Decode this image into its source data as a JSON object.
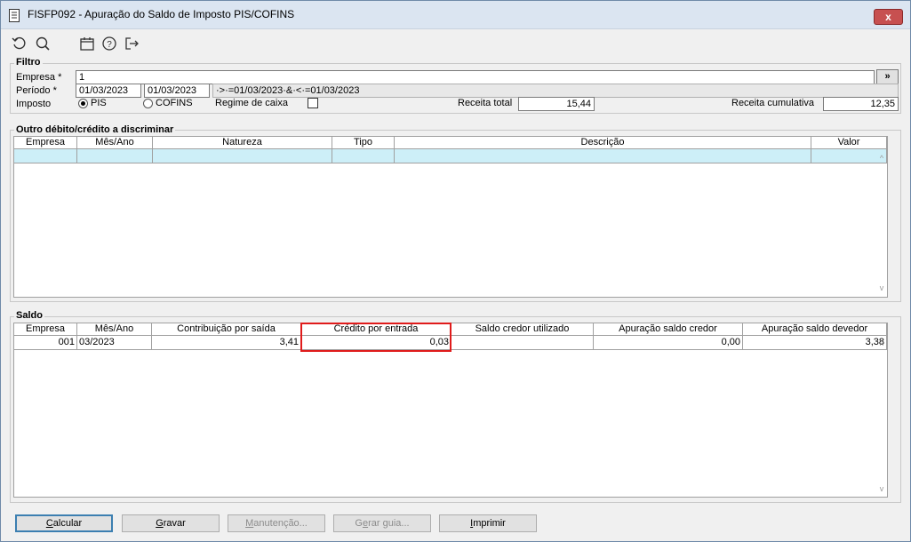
{
  "window": {
    "title": "FISFP092 - Apuração do Saldo de Imposto PIS/COFINS",
    "close_label": "x"
  },
  "toolbar": {
    "icons": [
      "refresh-icon",
      "search-icon",
      "calendar-icon",
      "help-icon",
      "exit-icon"
    ]
  },
  "filtro": {
    "legend": "Filtro",
    "empresa_label": "Empresa *",
    "empresa_value": "1",
    "lookup_label": "»",
    "periodo_label": "Período *",
    "periodo_de": "01/03/2023",
    "periodo_ate": "01/03/2023",
    "periodo_expr": "·>·=01/03/2023·&·<·=01/03/2023",
    "imposto_label": "Imposto",
    "imposto_options": [
      "PIS",
      "COFINS"
    ],
    "imposto_selected": "PIS",
    "regime_label": "Regime de caixa",
    "regime_checked": false,
    "receita_total_label": "Receita total",
    "receita_total_value": "15,44",
    "receita_cumulativa_label": "Receita cumulativa",
    "receita_cumulativa_value": "12,35"
  },
  "outros": {
    "legend": "Outro débito/crédito a discriminar",
    "columns": [
      "Empresa",
      "Mês/Ano",
      "Natureza",
      "Tipo",
      "Descrição",
      "Valor"
    ]
  },
  "saldo": {
    "legend": "Saldo",
    "columns": [
      "Empresa",
      "Mês/Ano",
      "Contribuição por saída",
      "Crédito por entrada",
      "Saldo credor utilizado",
      "Apuração saldo credor",
      "Apuração saldo devedor"
    ],
    "rows": [
      [
        "001",
        "03/2023",
        "3,41",
        "0,03",
        "",
        "0,00",
        "3,38"
      ]
    ]
  },
  "buttons": {
    "calcular": {
      "pre": "",
      "key": "C",
      "post": "alcular"
    },
    "gravar": {
      "pre": "",
      "key": "G",
      "post": "ravar"
    },
    "manutencao": {
      "pre": "",
      "key": "M",
      "post": "anutenção..."
    },
    "gerar": {
      "pre": "G",
      "key": "e",
      "post": "rar guia..."
    },
    "imprimir": {
      "pre": "",
      "key": "I",
      "post": "mprimir"
    }
  }
}
